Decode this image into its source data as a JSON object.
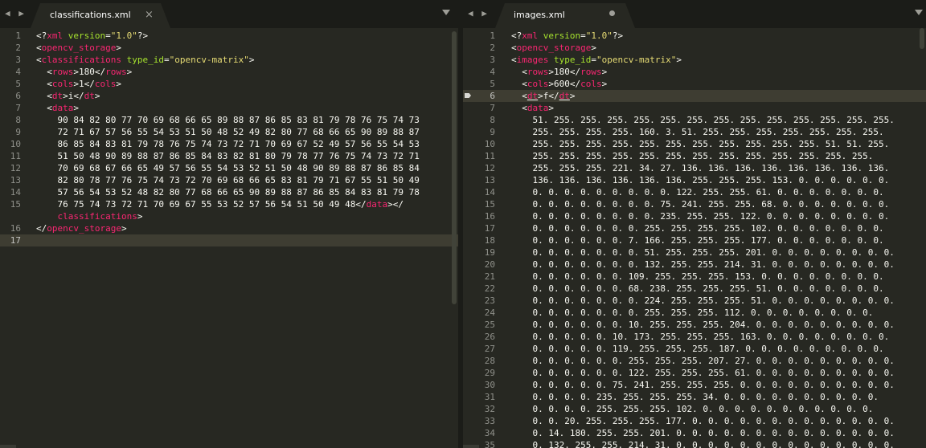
{
  "nav_glyph": "◀ ▶",
  "left": {
    "tab": {
      "label": "classifications.xml",
      "close": "×"
    },
    "current_line": 17,
    "lines": [
      [
        {
          "c": "p",
          "v": "<?"
        },
        {
          "c": "t",
          "v": "xml"
        },
        {
          "c": "p",
          "v": " "
        },
        {
          "c": "a",
          "v": "version"
        },
        {
          "c": "p",
          "v": "="
        },
        {
          "c": "s",
          "v": "\"1.0\""
        },
        {
          "c": "p",
          "v": "?>"
        }
      ],
      [
        {
          "c": "p",
          "v": "<"
        },
        {
          "c": "t",
          "v": "opencv_storage"
        },
        {
          "c": "p",
          "v": ">"
        }
      ],
      [
        {
          "c": "p",
          "v": "<"
        },
        {
          "c": "t",
          "v": "classifications"
        },
        {
          "c": "p",
          "v": " "
        },
        {
          "c": "a",
          "v": "type_id"
        },
        {
          "c": "p",
          "v": "="
        },
        {
          "c": "s",
          "v": "\"opencv-matrix\""
        },
        {
          "c": "p",
          "v": ">"
        }
      ],
      [
        {
          "c": "p",
          "v": "  <"
        },
        {
          "c": "t",
          "v": "rows"
        },
        {
          "c": "p",
          "v": ">180</"
        },
        {
          "c": "t",
          "v": "rows"
        },
        {
          "c": "p",
          "v": ">"
        }
      ],
      [
        {
          "c": "p",
          "v": "  <"
        },
        {
          "c": "t",
          "v": "cols"
        },
        {
          "c": "p",
          "v": ">1</"
        },
        {
          "c": "t",
          "v": "cols"
        },
        {
          "c": "p",
          "v": ">"
        }
      ],
      [
        {
          "c": "p",
          "v": "  <"
        },
        {
          "c": "t",
          "v": "dt"
        },
        {
          "c": "p",
          "v": ">i</"
        },
        {
          "c": "t",
          "v": "dt"
        },
        {
          "c": "p",
          "v": ">"
        }
      ],
      [
        {
          "c": "p",
          "v": "  <"
        },
        {
          "c": "t",
          "v": "data"
        },
        {
          "c": "p",
          "v": ">"
        }
      ],
      [
        {
          "c": "p",
          "v": "    90 84 82 80 77 70 69 68 66 65 89 88 87 86 85 83 81 79 78 76 75 74 73"
        }
      ],
      [
        {
          "c": "p",
          "v": "    72 71 67 57 56 55 54 53 51 50 48 52 49 82 80 77 68 66 65 90 89 88 87"
        }
      ],
      [
        {
          "c": "p",
          "v": "    86 85 84 83 81 79 78 76 75 74 73 72 71 70 69 67 52 49 57 56 55 54 53"
        }
      ],
      [
        {
          "c": "p",
          "v": "    51 50 48 90 89 88 87 86 85 84 83 82 81 80 79 78 77 76 75 74 73 72 71"
        }
      ],
      [
        {
          "c": "p",
          "v": "    70 69 68 67 66 65 49 57 56 55 54 53 52 51 50 48 90 89 88 87 86 85 84"
        }
      ],
      [
        {
          "c": "p",
          "v": "    82 80 78 77 76 75 74 73 72 70 69 68 66 65 83 81 79 71 67 55 51 50 49"
        }
      ],
      [
        {
          "c": "p",
          "v": "    57 56 54 53 52 48 82 80 77 68 66 65 90 89 88 87 86 85 84 83 81 79 78"
        }
      ],
      [
        {
          "c": "p",
          "v": "    76 75 74 73 72 71 70 69 67 55 53 52 57 56 54 51 50 49 48</"
        },
        {
          "c": "t",
          "v": "data"
        },
        {
          "c": "p",
          "v": "></"
        }
      ],
      [
        {
          "c": "p",
          "v": "    "
        },
        {
          "c": "t",
          "v": "classifications"
        },
        {
          "c": "p",
          "v": ">"
        }
      ],
      [
        {
          "c": "p",
          "v": "</"
        },
        {
          "c": "t",
          "v": "opencv_storage"
        },
        {
          "c": "p",
          "v": ">"
        }
      ],
      []
    ],
    "line_numbers": [
      "1",
      "2",
      "3",
      "4",
      "5",
      "6",
      "7",
      "8",
      "9",
      "10",
      "11",
      "12",
      "13",
      "14",
      "15",
      "",
      "16",
      "17"
    ]
  },
  "right": {
    "tab": {
      "label": "images.xml"
    },
    "current_line": 6,
    "bookmark_line": 6,
    "lines": [
      [
        {
          "c": "p",
          "v": "<?"
        },
        {
          "c": "t",
          "v": "xml"
        },
        {
          "c": "p",
          "v": " "
        },
        {
          "c": "a",
          "v": "version"
        },
        {
          "c": "p",
          "v": "="
        },
        {
          "c": "s",
          "v": "\"1.0\""
        },
        {
          "c": "p",
          "v": "?>"
        }
      ],
      [
        {
          "c": "p",
          "v": "<"
        },
        {
          "c": "t",
          "v": "opencv_storage"
        },
        {
          "c": "p",
          "v": ">"
        }
      ],
      [
        {
          "c": "p",
          "v": "<"
        },
        {
          "c": "t",
          "v": "images"
        },
        {
          "c": "p",
          "v": " "
        },
        {
          "c": "a",
          "v": "type_id"
        },
        {
          "c": "p",
          "v": "="
        },
        {
          "c": "s",
          "v": "\"opencv-matrix\""
        },
        {
          "c": "p",
          "v": ">"
        }
      ],
      [
        {
          "c": "p",
          "v": "  <"
        },
        {
          "c": "t",
          "v": "rows"
        },
        {
          "c": "p",
          "v": ">180</"
        },
        {
          "c": "t",
          "v": "rows"
        },
        {
          "c": "p",
          "v": ">"
        }
      ],
      [
        {
          "c": "p",
          "v": "  <"
        },
        {
          "c": "t",
          "v": "cols"
        },
        {
          "c": "p",
          "v": ">600</"
        },
        {
          "c": "t",
          "v": "cols"
        },
        {
          "c": "p",
          "v": ">"
        }
      ],
      [
        {
          "c": "p",
          "v": "  <"
        },
        {
          "c": "tu",
          "v": "dt"
        },
        {
          "c": "p",
          "v": ">f</"
        },
        {
          "c": "tu",
          "v": "dt"
        },
        {
          "c": "p",
          "v": ">"
        }
      ],
      [
        {
          "c": "p",
          "v": "  <"
        },
        {
          "c": "t",
          "v": "data"
        },
        {
          "c": "p",
          "v": ">"
        }
      ],
      [
        {
          "c": "p",
          "v": "    51. 255. 255. 255. 255. 255. 255. 255. 255. 255. 255. 255. 255. 255."
        }
      ],
      [
        {
          "c": "p",
          "v": "    255. 255. 255. 255. 160. 3. 51. 255. 255. 255. 255. 255. 255. 255."
        }
      ],
      [
        {
          "c": "p",
          "v": "    255. 255. 255. 255. 255. 255. 255. 255. 255. 255. 255. 51. 51. 255."
        }
      ],
      [
        {
          "c": "p",
          "v": "    255. 255. 255. 255. 255. 255. 255. 255. 255. 255. 255. 255. 255."
        }
      ],
      [
        {
          "c": "p",
          "v": "    255. 255. 255. 221. 34. 27. 136. 136. 136. 136. 136. 136. 136. 136."
        }
      ],
      [
        {
          "c": "p",
          "v": "    136. 136. 136. 136. 136. 136. 255. 255. 255. 153. 0. 0. 0. 0. 0. 0."
        }
      ],
      [
        {
          "c": "p",
          "v": "    0. 0. 0. 0. 0. 0. 0. 0. 0. 122. 255. 255. 61. 0. 0. 0. 0. 0. 0. 0."
        }
      ],
      [
        {
          "c": "p",
          "v": "    0. 0. 0. 0. 0. 0. 0. 0. 75. 241. 255. 255. 68. 0. 0. 0. 0. 0. 0. 0."
        }
      ],
      [
        {
          "c": "p",
          "v": "    0. 0. 0. 0. 0. 0. 0. 0. 235. 255. 255. 122. 0. 0. 0. 0. 0. 0. 0. 0."
        }
      ],
      [
        {
          "c": "p",
          "v": "    0. 0. 0. 0. 0. 0. 0. 255. 255. 255. 255. 102. 0. 0. 0. 0. 0. 0. 0."
        }
      ],
      [
        {
          "c": "p",
          "v": "    0. 0. 0. 0. 0. 0. 7. 166. 255. 255. 255. 177. 0. 0. 0. 0. 0. 0. 0."
        }
      ],
      [
        {
          "c": "p",
          "v": "    0. 0. 0. 0. 0. 0. 0. 51. 255. 255. 255. 201. 0. 0. 0. 0. 0. 0. 0. 0."
        }
      ],
      [
        {
          "c": "p",
          "v": "    0. 0. 0. 0. 0. 0. 0. 132. 255. 255. 214. 31. 0. 0. 0. 0. 0. 0. 0. 0."
        }
      ],
      [
        {
          "c": "p",
          "v": "    0. 0. 0. 0. 0. 0. 109. 255. 255. 255. 153. 0. 0. 0. 0. 0. 0. 0. 0."
        }
      ],
      [
        {
          "c": "p",
          "v": "    0. 0. 0. 0. 0. 0. 68. 238. 255. 255. 255. 51. 0. 0. 0. 0. 0. 0. 0."
        }
      ],
      [
        {
          "c": "p",
          "v": "    0. 0. 0. 0. 0. 0. 0. 224. 255. 255. 255. 51. 0. 0. 0. 0. 0. 0. 0. 0."
        }
      ],
      [
        {
          "c": "p",
          "v": "    0. 0. 0. 0. 0. 0. 0. 255. 255. 255. 112. 0. 0. 0. 0. 0. 0. 0. 0."
        }
      ],
      [
        {
          "c": "p",
          "v": "    0. 0. 0. 0. 0. 0. 10. 255. 255. 255. 204. 0. 0. 0. 0. 0. 0. 0. 0. 0."
        }
      ],
      [
        {
          "c": "p",
          "v": "    0. 0. 0. 0. 0. 10. 173. 255. 255. 255. 163. 0. 0. 0. 0. 0. 0. 0. 0."
        }
      ],
      [
        {
          "c": "p",
          "v": "    0. 0. 0. 0. 0. 119. 255. 255. 255. 187. 0. 0. 0. 0. 0. 0. 0. 0. 0."
        }
      ],
      [
        {
          "c": "p",
          "v": "    0. 0. 0. 0. 0. 0. 255. 255. 255. 207. 27. 0. 0. 0. 0. 0. 0. 0. 0. 0."
        }
      ],
      [
        {
          "c": "p",
          "v": "    0. 0. 0. 0. 0. 0. 122. 255. 255. 255. 61. 0. 0. 0. 0. 0. 0. 0. 0. 0."
        }
      ],
      [
        {
          "c": "p",
          "v": "    0. 0. 0. 0. 0. 75. 241. 255. 255. 255. 0. 0. 0. 0. 0. 0. 0. 0. 0. 0."
        }
      ],
      [
        {
          "c": "p",
          "v": "    0. 0. 0. 0. 235. 255. 255. 255. 34. 0. 0. 0. 0. 0. 0. 0. 0. 0. 0."
        }
      ],
      [
        {
          "c": "p",
          "v": "    0. 0. 0. 0. 255. 255. 255. 102. 0. 0. 0. 0. 0. 0. 0. 0. 0. 0. 0."
        }
      ],
      [
        {
          "c": "p",
          "v": "    0. 0. 20. 255. 255. 255. 177. 0. 0. 0. 0. 0. 0. 0. 0. 0. 0. 0. 0. 0."
        }
      ],
      [
        {
          "c": "p",
          "v": "    0. 14. 180. 255. 255. 201. 0. 0. 0. 0. 0. 0. 0. 0. 0. 0. 0. 0. 0. 0."
        }
      ],
      [
        {
          "c": "p",
          "v": "    0. 132. 255. 255. 214. 31. 0. 0. 0. 0. 0. 0. 0. 0. 0. 0. 0. 0. 0. 0."
        }
      ]
    ],
    "line_numbers": [
      "1",
      "2",
      "3",
      "4",
      "5",
      "6",
      "7",
      "8",
      "9",
      "10",
      "11",
      "12",
      "13",
      "14",
      "15",
      "16",
      "17",
      "18",
      "19",
      "20",
      "21",
      "22",
      "23",
      "24",
      "25",
      "26",
      "27",
      "28",
      "29",
      "30",
      "31",
      "32",
      "33",
      "34",
      "35"
    ]
  }
}
